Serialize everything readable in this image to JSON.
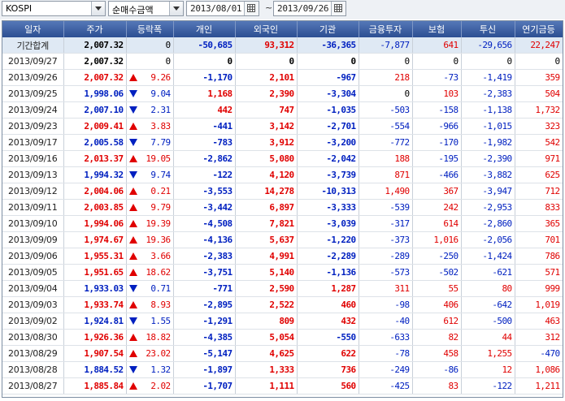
{
  "toolbar": {
    "market": "KOSPI",
    "type": "순매수금액",
    "start_date": "2013/08/01",
    "separator": "~",
    "end_date": "2013/09/26"
  },
  "colors": {
    "up": "#e00000",
    "down": "#0020c0",
    "header": "#2c4f92"
  },
  "columns": [
    "일자",
    "주가",
    "등락폭",
    "개인",
    "외국인",
    "기관",
    "금융투자",
    "보험",
    "투신",
    "연기금등"
  ],
  "rows": [
    {
      "date": "기간합계",
      "price": "2,007.32",
      "dir": "",
      "chg": "0",
      "ind": "-50,685",
      "frn": "93,312",
      "inst": "-36,365",
      "fin": "-7,877",
      "ins": "641",
      "trust": "-29,656",
      "pension": "22,247"
    },
    {
      "date": "2013/09/27",
      "price": "2,007.32",
      "dir": "",
      "chg": "0",
      "ind": "0",
      "frn": "0",
      "inst": "0",
      "fin": "0",
      "ins": "0",
      "trust": "0",
      "pension": "0"
    },
    {
      "date": "2013/09/26",
      "price": "2,007.32",
      "dir": "up",
      "chg": "9.26",
      "ind": "-1,170",
      "frn": "2,101",
      "inst": "-967",
      "fin": "218",
      "ins": "-73",
      "trust": "-1,419",
      "pension": "359"
    },
    {
      "date": "2013/09/25",
      "price": "1,998.06",
      "dir": "down",
      "chg": "9.04",
      "ind": "1,168",
      "frn": "2,390",
      "inst": "-3,304",
      "fin": "0",
      "ins": "103",
      "trust": "-2,383",
      "pension": "504"
    },
    {
      "date": "2013/09/24",
      "price": "2,007.10",
      "dir": "down",
      "chg": "2.31",
      "ind": "442",
      "frn": "747",
      "inst": "-1,035",
      "fin": "-503",
      "ins": "-158",
      "trust": "-1,138",
      "pension": "1,732"
    },
    {
      "date": "2013/09/23",
      "price": "2,009.41",
      "dir": "up",
      "chg": "3.83",
      "ind": "-441",
      "frn": "3,142",
      "inst": "-2,701",
      "fin": "-554",
      "ins": "-966",
      "trust": "-1,015",
      "pension": "323"
    },
    {
      "date": "2013/09/17",
      "price": "2,005.58",
      "dir": "down",
      "chg": "7.79",
      "ind": "-783",
      "frn": "3,912",
      "inst": "-3,200",
      "fin": "-772",
      "ins": "-170",
      "trust": "-1,982",
      "pension": "542"
    },
    {
      "date": "2013/09/16",
      "price": "2,013.37",
      "dir": "up",
      "chg": "19.05",
      "ind": "-2,862",
      "frn": "5,080",
      "inst": "-2,042",
      "fin": "188",
      "ins": "-195",
      "trust": "-2,390",
      "pension": "971"
    },
    {
      "date": "2013/09/13",
      "price": "1,994.32",
      "dir": "down",
      "chg": "9.74",
      "ind": "-122",
      "frn": "4,120",
      "inst": "-3,739",
      "fin": "871",
      "ins": "-466",
      "trust": "-3,882",
      "pension": "625"
    },
    {
      "date": "2013/09/12",
      "price": "2,004.06",
      "dir": "up",
      "chg": "0.21",
      "ind": "-3,553",
      "frn": "14,278",
      "inst": "-10,313",
      "fin": "1,490",
      "ins": "367",
      "trust": "-3,947",
      "pension": "712"
    },
    {
      "date": "2013/09/11",
      "price": "2,003.85",
      "dir": "up",
      "chg": "9.79",
      "ind": "-3,442",
      "frn": "6,897",
      "inst": "-3,333",
      "fin": "-539",
      "ins": "242",
      "trust": "-2,953",
      "pension": "833"
    },
    {
      "date": "2013/09/10",
      "price": "1,994.06",
      "dir": "up",
      "chg": "19.39",
      "ind": "-4,508",
      "frn": "7,821",
      "inst": "-3,039",
      "fin": "-317",
      "ins": "614",
      "trust": "-2,860",
      "pension": "365"
    },
    {
      "date": "2013/09/09",
      "price": "1,974.67",
      "dir": "up",
      "chg": "19.36",
      "ind": "-4,136",
      "frn": "5,637",
      "inst": "-1,220",
      "fin": "-373",
      "ins": "1,016",
      "trust": "-2,056",
      "pension": "701"
    },
    {
      "date": "2013/09/06",
      "price": "1,955.31",
      "dir": "up",
      "chg": "3.66",
      "ind": "-2,383",
      "frn": "4,991",
      "inst": "-2,289",
      "fin": "-289",
      "ins": "-250",
      "trust": "-1,424",
      "pension": "786"
    },
    {
      "date": "2013/09/05",
      "price": "1,951.65",
      "dir": "up",
      "chg": "18.62",
      "ind": "-3,751",
      "frn": "5,140",
      "inst": "-1,136",
      "fin": "-573",
      "ins": "-502",
      "trust": "-621",
      "pension": "571"
    },
    {
      "date": "2013/09/04",
      "price": "1,933.03",
      "dir": "down",
      "chg": "0.71",
      "ind": "-771",
      "frn": "2,590",
      "inst": "1,287",
      "fin": "311",
      "ins": "55",
      "trust": "80",
      "pension": "999"
    },
    {
      "date": "2013/09/03",
      "price": "1,933.74",
      "dir": "up",
      "chg": "8.93",
      "ind": "-2,895",
      "frn": "2,522",
      "inst": "460",
      "fin": "-98",
      "ins": "406",
      "trust": "-642",
      "pension": "1,019"
    },
    {
      "date": "2013/09/02",
      "price": "1,924.81",
      "dir": "down",
      "chg": "1.55",
      "ind": "-1,291",
      "frn": "809",
      "inst": "432",
      "fin": "-40",
      "ins": "612",
      "trust": "-500",
      "pension": "463"
    },
    {
      "date": "2013/08/30",
      "price": "1,926.36",
      "dir": "up",
      "chg": "18.82",
      "ind": "-4,385",
      "frn": "5,054",
      "inst": "-550",
      "fin": "-633",
      "ins": "82",
      "trust": "44",
      "pension": "312"
    },
    {
      "date": "2013/08/29",
      "price": "1,907.54",
      "dir": "up",
      "chg": "23.02",
      "ind": "-5,147",
      "frn": "4,625",
      "inst": "622",
      "fin": "-78",
      "ins": "458",
      "trust": "1,255",
      "pension": "-470"
    },
    {
      "date": "2013/08/28",
      "price": "1,884.52",
      "dir": "down",
      "chg": "1.32",
      "ind": "-1,897",
      "frn": "1,333",
      "inst": "736",
      "fin": "-249",
      "ins": "-86",
      "trust": "12",
      "pension": "1,086"
    },
    {
      "date": "2013/08/27",
      "price": "1,885.84",
      "dir": "up",
      "chg": "2.02",
      "ind": "-1,707",
      "frn": "1,111",
      "inst": "560",
      "fin": "-425",
      "ins": "83",
      "trust": "-122",
      "pension": "1,211"
    }
  ]
}
